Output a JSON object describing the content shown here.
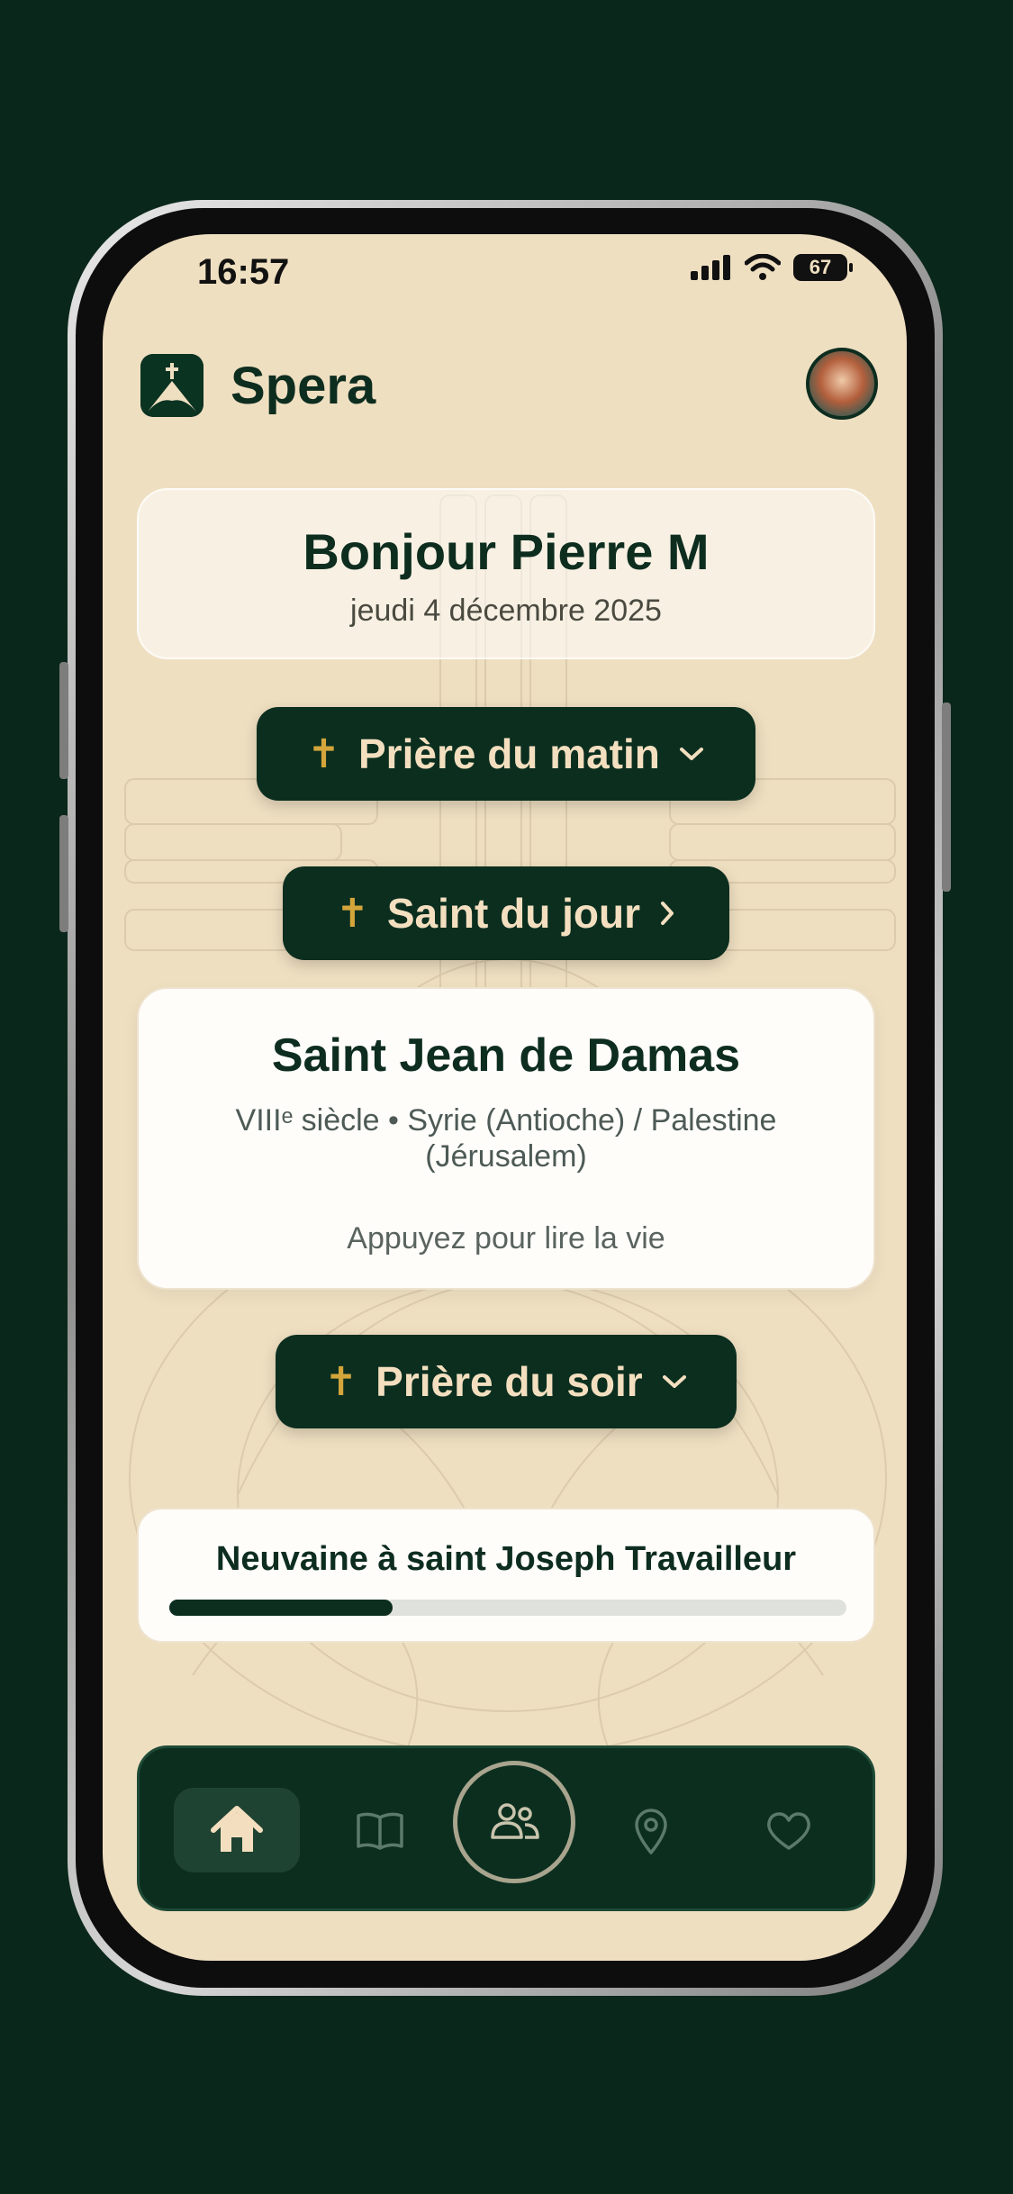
{
  "status_bar": {
    "time": "16:57",
    "battery": "67"
  },
  "header": {
    "app_title": "Spera"
  },
  "greeting": {
    "title": "Bonjour Pierre M",
    "date": "jeudi 4 décembre 2025"
  },
  "morning_prayer": {
    "label": "Prière du matin",
    "icon": "cross-icon",
    "chevron": "chevron-down-icon"
  },
  "saint_button": {
    "label": "Saint du jour",
    "icon": "cross-icon",
    "chevron": "chevron-right-icon"
  },
  "saint": {
    "name": "Saint Jean de Damas",
    "info": "VIIIᵉ siècle • Syrie (Antioche) / Palestine (Jérusalem)",
    "hint": "Appuyez pour lire la vie"
  },
  "evening_prayer": {
    "label": "Prière du soir",
    "icon": "cross-icon",
    "chevron": "chevron-down-icon"
  },
  "novena": {
    "title": "Neuvaine à saint Joseph Travailleur",
    "progress": 0.33
  },
  "nav": {
    "items": [
      "home-icon",
      "book-icon",
      "community-icon",
      "location-icon",
      "heart-icon"
    ],
    "active": "home-icon"
  },
  "colors": {
    "background": "#0a271b",
    "screen": "#efdfc1",
    "primary": "#0b2e1f",
    "accent_cross": "#d4a53b",
    "pill_text": "#f3dfbf"
  }
}
